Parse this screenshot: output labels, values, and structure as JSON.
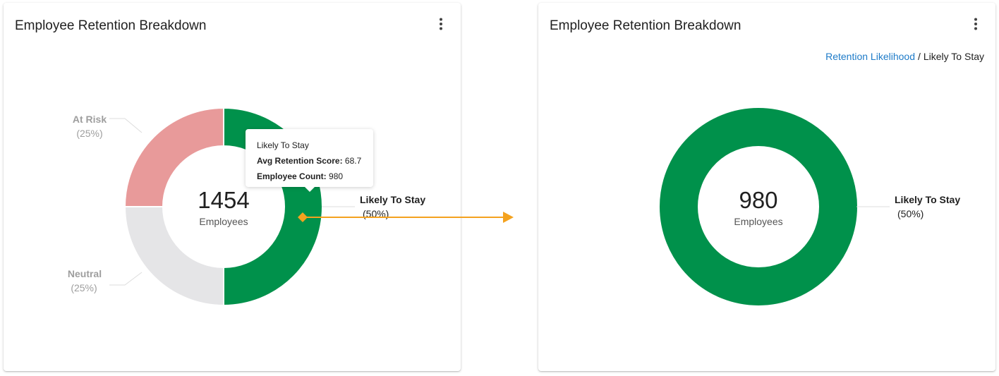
{
  "colors": {
    "likely_to_stay": "#00914b",
    "at_risk": "#e89a9a",
    "neutral": "#e5e5e7",
    "leader_line": "#dddddd",
    "callout_arrow": "#f4a21f",
    "link": "#1e7bc8"
  },
  "left_card": {
    "title": "Employee Retention Breakdown",
    "menu_icon": "more-vertical-icon",
    "center_value": "1454",
    "center_label": "Employees",
    "labels": {
      "at_risk_name": "At Risk",
      "at_risk_pct": "(25%)",
      "neutral_name": "Neutral",
      "neutral_pct": "(25%)",
      "likely_name": "Likely To Stay",
      "likely_pct": "(50%)"
    },
    "tooltip": {
      "title": "Likely To Stay",
      "score_label": "Avg Retention Score:",
      "score_value": "68.7",
      "count_label": "Employee Count:",
      "count_value": "980"
    },
    "chart_data": {
      "type": "pie",
      "categories": [
        "Likely To Stay",
        "Neutral",
        "At Risk"
      ],
      "values": [
        50,
        25,
        25
      ],
      "unit": "%"
    }
  },
  "right_card": {
    "title": "Employee Retention Breakdown",
    "menu_icon": "more-vertical-icon",
    "breadcrumb": {
      "parent": "Retention Likelihood",
      "separator": "/",
      "current": "Likely To Stay"
    },
    "center_value": "980",
    "center_label": "Employees",
    "labels": {
      "likely_name": "Likely To Stay",
      "likely_pct": "(50%)"
    },
    "chart_data": {
      "type": "pie",
      "categories": [
        "Likely To Stay"
      ],
      "values": [
        100
      ]
    }
  }
}
